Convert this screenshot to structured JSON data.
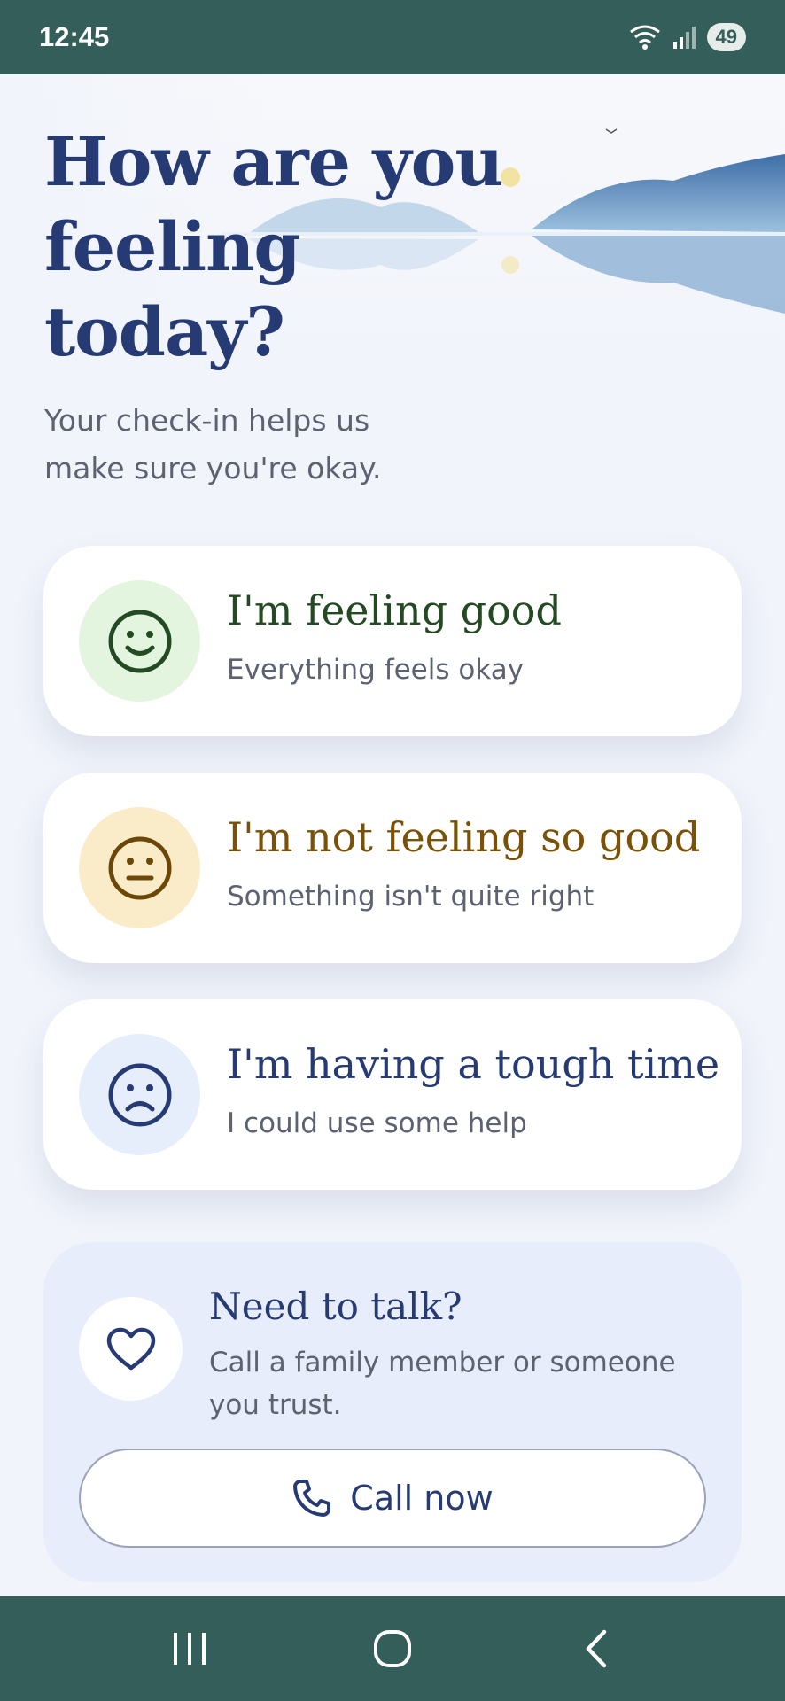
{
  "status_bar": {
    "time": "12:45",
    "battery": "49",
    "icons": [
      "wifi-icon",
      "signal-icon",
      "battery-icon"
    ]
  },
  "header": {
    "title": "How are you feeling today?",
    "subtitle": "Your check-in helps us make sure you're okay."
  },
  "moods": [
    {
      "title": "I'm feeling good",
      "subtitle": "Everything feels okay",
      "icon": "smile-face-icon",
      "title_color": "#234a22",
      "icon_bg": "#e3f5df",
      "icon_color": "#234a22"
    },
    {
      "title": "I'm not feeling so good",
      "subtitle": "Something isn't quite right",
      "icon": "neutral-face-icon",
      "title_color": "#7a5207",
      "icon_bg": "#fbecc9",
      "icon_color": "#6b4708"
    },
    {
      "title": "I'm having a tough time",
      "subtitle": "I could use some help",
      "icon": "sad-face-icon",
      "title_color": "#263a74",
      "icon_bg": "#e6edfb",
      "icon_color": "#263a74"
    }
  ],
  "support": {
    "title": "Need to talk?",
    "text": "Call a family member or someone you trust.",
    "button_label": "Call now",
    "icon": "heart-icon",
    "button_icon": "phone-icon"
  },
  "nav": {
    "items": [
      "recent-apps-icon",
      "home-icon",
      "back-icon"
    ]
  },
  "colors": {
    "system_bar": "#345e59",
    "background": "#f1f4fb",
    "primary_text": "#263a74",
    "support_panel": "#e8edfb"
  }
}
